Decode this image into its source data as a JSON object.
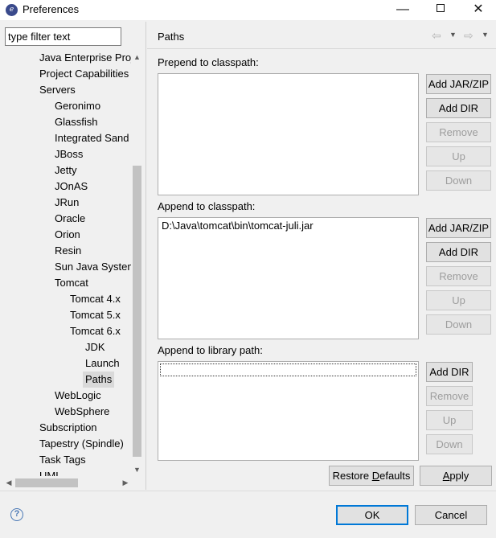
{
  "window": {
    "title": "Preferences",
    "minimize_glyph": "—",
    "close_glyph": "✕"
  },
  "filter": {
    "placeholder": "type filter text",
    "value": "type filter text"
  },
  "tree": {
    "items": [
      {
        "label": "Java Enterprise Proj",
        "level": 1
      },
      {
        "label": "Project Capabilities",
        "level": 1
      },
      {
        "label": "Servers",
        "level": 1
      },
      {
        "label": "Geronimo",
        "level": 2
      },
      {
        "label": "Glassfish",
        "level": 2
      },
      {
        "label": "Integrated Sand",
        "level": 2
      },
      {
        "label": "JBoss",
        "level": 2
      },
      {
        "label": "Jetty",
        "level": 2
      },
      {
        "label": "JOnAS",
        "level": 2
      },
      {
        "label": "JRun",
        "level": 2
      },
      {
        "label": "Oracle",
        "level": 2
      },
      {
        "label": "Orion",
        "level": 2
      },
      {
        "label": "Resin",
        "level": 2
      },
      {
        "label": "Sun Java System",
        "level": 2
      },
      {
        "label": "Tomcat",
        "level": 2
      },
      {
        "label": "Tomcat  4.x",
        "level": 3
      },
      {
        "label": "Tomcat  5.x",
        "level": 3
      },
      {
        "label": "Tomcat  6.x",
        "level": 3
      },
      {
        "label": "JDK",
        "level": 4
      },
      {
        "label": "Launch",
        "level": 4
      },
      {
        "label": "Paths",
        "level": 4,
        "selected": true
      },
      {
        "label": "WebLogic",
        "level": 2
      },
      {
        "label": "WebSphere",
        "level": 2
      },
      {
        "label": "Subscription",
        "level": 1
      },
      {
        "label": "Tapestry (Spindle)",
        "level": 1
      },
      {
        "label": "Task Tags",
        "level": 1
      },
      {
        "label": "UML",
        "level": 1
      }
    ]
  },
  "page": {
    "title": "Paths",
    "back_icon": "back-arrow-icon",
    "forward_icon": "forward-arrow-icon"
  },
  "prepend": {
    "label": "Prepend to classpath:",
    "entries": [],
    "buttons": {
      "add_jar": "Add JAR/ZIP",
      "add_dir": "Add DIR",
      "remove": "Remove",
      "up": "Up",
      "down": "Down"
    }
  },
  "append": {
    "label": "Append to classpath:",
    "entries": [
      "D:\\Java\\tomcat\\bin\\tomcat-juli.jar"
    ],
    "buttons": {
      "add_jar": "Add JAR/ZIP",
      "add_dir": "Add DIR",
      "remove": "Remove",
      "up": "Up",
      "down": "Down"
    }
  },
  "library": {
    "label": "Append to library path:",
    "entries": [],
    "buttons": {
      "add_dir": "Add DIR",
      "remove": "Remove",
      "up": "Up",
      "down": "Down"
    }
  },
  "actions": {
    "restore_defaults_pre": "Restore ",
    "restore_defaults_mnemonic": "D",
    "restore_defaults_post": "efaults",
    "apply_mnemonic": "A",
    "apply_post": "pply"
  },
  "dialog": {
    "help_glyph": "?",
    "ok": "OK",
    "cancel": "Cancel"
  },
  "colors": {
    "accent": "#0078d7",
    "disabled_text": "#9d9d9d"
  }
}
